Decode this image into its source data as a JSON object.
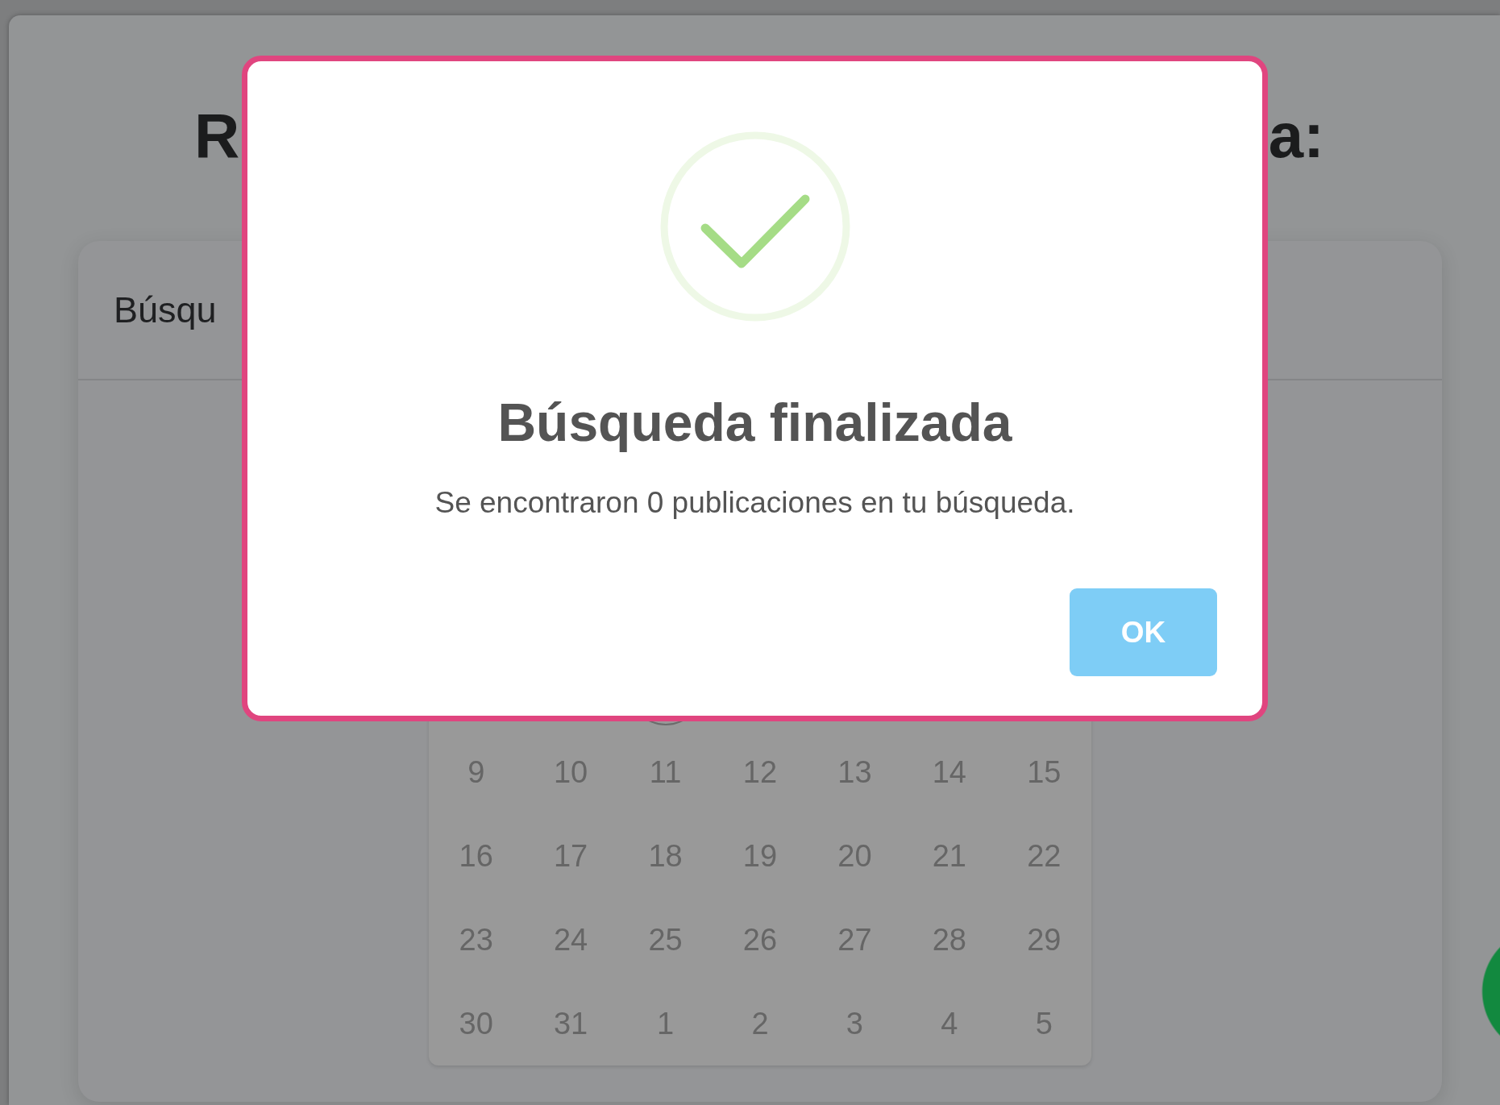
{
  "page": {
    "heading_left": "R",
    "heading_right": "a:"
  },
  "search_card": {
    "header": "Búsqu"
  },
  "calendar": {
    "weeks": [
      [
        "9",
        "10",
        "11",
        "12",
        "13",
        "14",
        "15"
      ],
      [
        "16",
        "17",
        "18",
        "19",
        "20",
        "21",
        "22"
      ],
      [
        "23",
        "24",
        "25",
        "26",
        "27",
        "28",
        "29"
      ],
      [
        "30",
        "31",
        "1",
        "2",
        "3",
        "4",
        "5"
      ]
    ]
  },
  "dialog": {
    "title": "Búsqueda finalizada",
    "message": "Se encontraron 0 publicaciones en tu búsqueda.",
    "button": "OK"
  }
}
